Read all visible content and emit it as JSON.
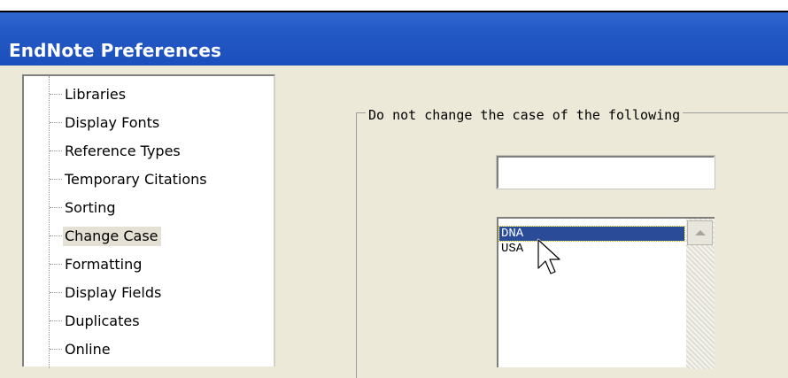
{
  "window": {
    "title": "EndNote Preferences"
  },
  "tree": {
    "items": [
      {
        "label": "Libraries"
      },
      {
        "label": "Display Fonts"
      },
      {
        "label": "Reference Types"
      },
      {
        "label": "Temporary Citations"
      },
      {
        "label": "Sorting"
      },
      {
        "label": "Change Case",
        "selected": true
      },
      {
        "label": "Formatting"
      },
      {
        "label": "Display Fields"
      },
      {
        "label": "Duplicates"
      },
      {
        "label": "Online"
      }
    ]
  },
  "change_case": {
    "group_label": "Do not change the case of the following",
    "input_value": "",
    "list_items": [
      {
        "label": "DNA",
        "selected": true
      },
      {
        "label": "USA"
      }
    ]
  },
  "icons": {
    "cursor": "arrow-cursor-icon",
    "scroll_up": "scroll-up-arrow-icon"
  },
  "colors": {
    "title_bar": "#2258c4",
    "selection": "#2a4c98",
    "background": "#ece9d8"
  }
}
